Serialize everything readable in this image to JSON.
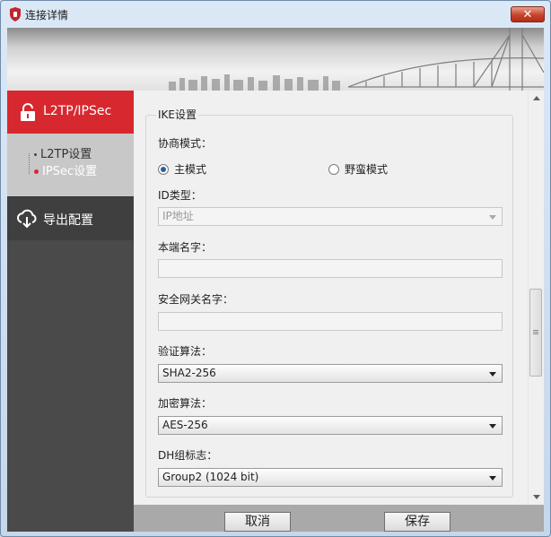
{
  "window": {
    "title": "连接详情",
    "close_label": "✕"
  },
  "sidebar": {
    "main_item": "L2TP/IPSec",
    "sub_items": [
      "L2TP设置",
      "IPSec设置"
    ],
    "export_item": "导出配置"
  },
  "form": {
    "group_title": "IKE设置",
    "negotiation": {
      "label": "协商模式：",
      "options": [
        "主模式",
        "野蛮模式"
      ],
      "selected": "主模式"
    },
    "id_type": {
      "label": "ID类型：",
      "value": "IP地址"
    },
    "local_name": {
      "label": "本端名字：",
      "value": ""
    },
    "gateway_name": {
      "label": "安全网关名字：",
      "value": ""
    },
    "auth_algo": {
      "label": "验证算法：",
      "value": "SHA2-256"
    },
    "enc_algo": {
      "label": "加密算法：",
      "value": "AES-256"
    },
    "dh_group": {
      "label": "DH组标志：",
      "value": "Group2 (1024 bit)"
    }
  },
  "buttons": {
    "cancel": "取消",
    "save": "保存"
  },
  "colors": {
    "accent": "#d8282f",
    "sidebar_bg": "#4a4a4a",
    "sub_bg": "#c8c8c8"
  }
}
